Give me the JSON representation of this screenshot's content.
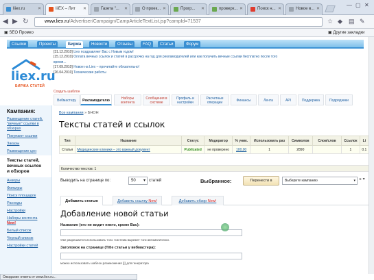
{
  "browser": {
    "tabs": [
      {
        "label": "liiex.ru",
        "color": "#3a8fd2"
      },
      {
        "label": "liiEX – Лит",
        "color": "#e5531d"
      },
      {
        "label": "Газета \"...",
        "color": "#9aa3ad"
      },
      {
        "label": "О проек...",
        "color": "#9aa3ad"
      },
      {
        "label": "Прогр...",
        "color": "#6aa84f"
      },
      {
        "label": "проверк...",
        "color": "#6aa84f"
      },
      {
        "label": "Поиск н...",
        "color": "#e03b2e"
      },
      {
        "label": "Новое в...",
        "color": "#9aa3ad"
      }
    ],
    "url_domain": "www.liex.ru",
    "url_path": "/Advertiser/Campaign/CampArticleTextList.jsp?campId=71537",
    "bookmark": "SEO Промко",
    "other_bookmarks": "Другие закладки"
  },
  "site": {
    "top_nav": [
      "Ссылки",
      "Проекты",
      "Биржа",
      "Новости",
      "Отзывы",
      "FAQ",
      "Статьи",
      "Форум"
    ],
    "logo_text": "liex.ru",
    "logo_sub": "БИРЖА СТАТЕЙ",
    "news": [
      {
        "date": "[31.12.2010]",
        "text": "Liex поздравляет Вас с Новым годом!"
      },
      {
        "date": "[15.12.2010]",
        "text": "Оплата вечных ссылок и статей в рассрочку на год для рекламодателей или как получить вечные ссылки бесплатно после того"
      },
      {
        "date": "",
        "text": "время..."
      },
      {
        "date": "[17.09.2010]",
        "text": "Новое на Liex – прочитайте обязательно!"
      },
      {
        "date": "[26.04.2010]",
        "text": "Технические работы"
      }
    ],
    "tabs2_caption": "Создать шаблон",
    "tabs2": [
      "Вебмастеру",
      "Рекламодателю",
      "Наборы контента",
      "Сообщения в системе",
      "Профиль и настройки",
      "Расчетные операции",
      "Финансы",
      "Лента",
      "API",
      "Поддержка",
      "Подрядчики"
    ]
  },
  "sidebar": {
    "title": "Кампания:",
    "items": [
      "Размещение статей, \"вечные\" ссылки в обзорах",
      "Покупают ссылки",
      "Заказы",
      "Размещение цен",
      "Тексты статей, вечных ссылок и обзоров",
      "Анкоры",
      "Фильтры",
      "Поиск площадок",
      "Расходы",
      "Настройки",
      "Наборы контента",
      "Белый список",
      "Черный список",
      "Настройки статей"
    ],
    "current_index": 4,
    "new_badge": "New!"
  },
  "main": {
    "crumb_link": "Все кампании",
    "crumb_current": "БНОН",
    "title": "Тексты статей и ссылок",
    "table": {
      "headers": [
        "Тип",
        "Название",
        "Статус",
        "Модератор",
        "% уник.",
        "Использовать раз",
        "Символов",
        "Слов/слов",
        "Ссылок",
        "Li"
      ],
      "rows": [
        [
          "Статья",
          "Медицинские клиники – это важный документ",
          "Publicated",
          "не проверено",
          "100,00",
          "1",
          "2890",
          "",
          "1",
          "0.1"
        ]
      ],
      "total": "Количество текстов: 1"
    },
    "perpage_label": "Выводить на странице по:",
    "perpage_value": "50",
    "perpage_suffix": "статей",
    "favorites_label": "Выбранное:",
    "move_button": "Перенести в",
    "target_select": "Выберите кампанию",
    "tabs": [
      "Добавить статью",
      "Добавить ссылку",
      "Добавить обзор"
    ],
    "new_mark": "New!",
    "add_title": "Добавление новой статьи",
    "field1_label": "Название (его не видит никто, кроме Вас):",
    "field1_hint": "Уже разрешается использовать тэги. Система вырежет тэги автоматически.",
    "field2_label": "Заголовок на странице (Title статьи у вебмастера):",
    "field2_hint": "можно использовать шаблон размножения {|} для генератора"
  },
  "status_text": "Ожидание ответа от www.liex.ru..."
}
